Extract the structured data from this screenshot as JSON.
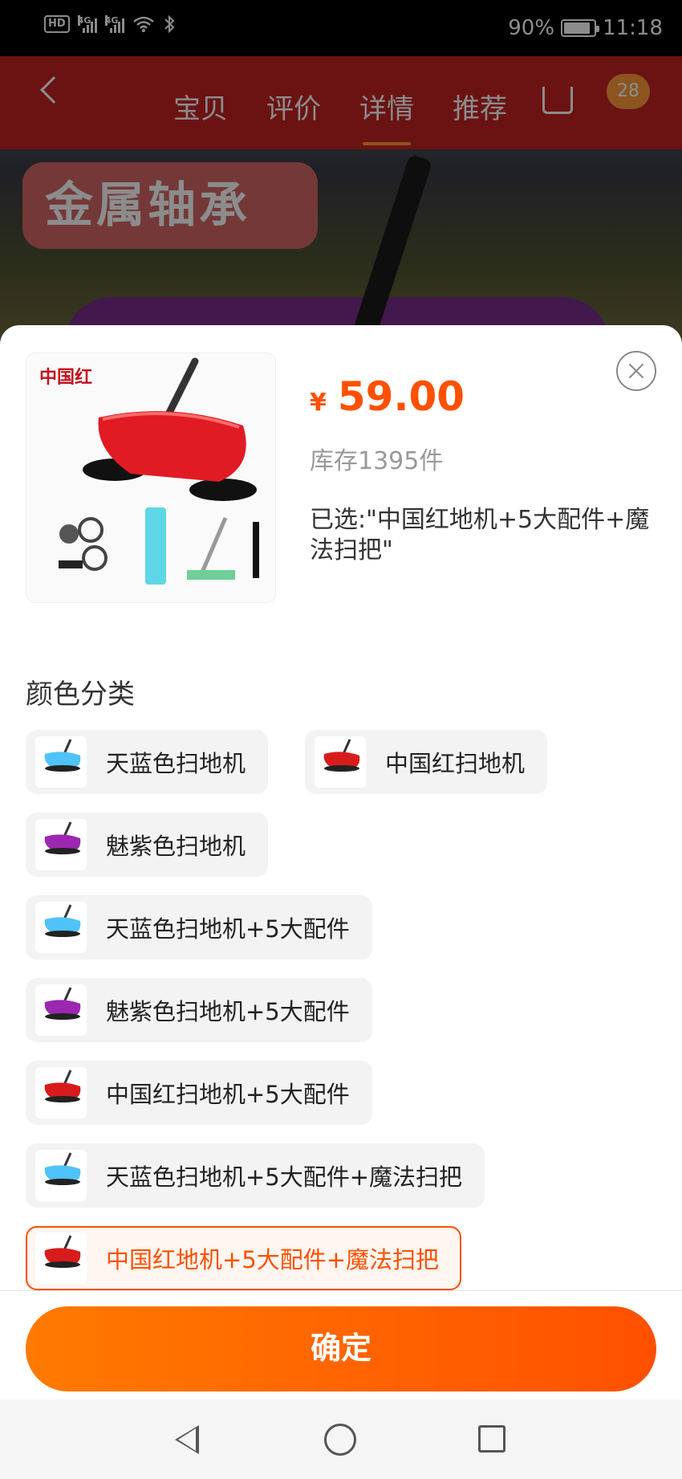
{
  "status_bar": {
    "hd": "HD",
    "signal1": "4G",
    "signal2": "4G",
    "battery_pct": "90%",
    "battery_level": 0.9,
    "time": "11:18"
  },
  "background_page": {
    "tabs": [
      "宝贝",
      "评价",
      "详情",
      "推荐"
    ],
    "active_tab": "详情",
    "cart_badge": "28",
    "banner_text": "金属轴承"
  },
  "product": {
    "brand_mark": "中国红",
    "currency": "¥",
    "price": "59.00",
    "stock": "库存1395件",
    "selected": "已选:\"中国红地机+5大配件+魔法扫把\""
  },
  "section": {
    "title": "颜色分类"
  },
  "options": [
    {
      "label": "天蓝色扫地机",
      "color": "#4fc3f7",
      "selected": false
    },
    {
      "label": "中国红扫地机",
      "color": "#d81b1b",
      "selected": false
    },
    {
      "label": "魅紫色扫地机",
      "color": "#9c27b0",
      "selected": false
    },
    {
      "label": "天蓝色扫地机+5大配件",
      "color": "#4fc3f7",
      "selected": false
    },
    {
      "label": "魅紫色扫地机+5大配件",
      "color": "#9c27b0",
      "selected": false
    },
    {
      "label": "中国红扫地机+5大配件",
      "color": "#d81b1b",
      "selected": false
    },
    {
      "label": "天蓝色扫地机+5大配件+魔法扫把",
      "color": "#4fc3f7",
      "selected": false
    },
    {
      "label": "中国红地机+5大配件+魔法扫把",
      "color": "#d81b1b",
      "selected": true
    }
  ],
  "confirm_label": "确定",
  "colors": {
    "accent": "#ff5000",
    "accent_start": "#ff7a00"
  }
}
